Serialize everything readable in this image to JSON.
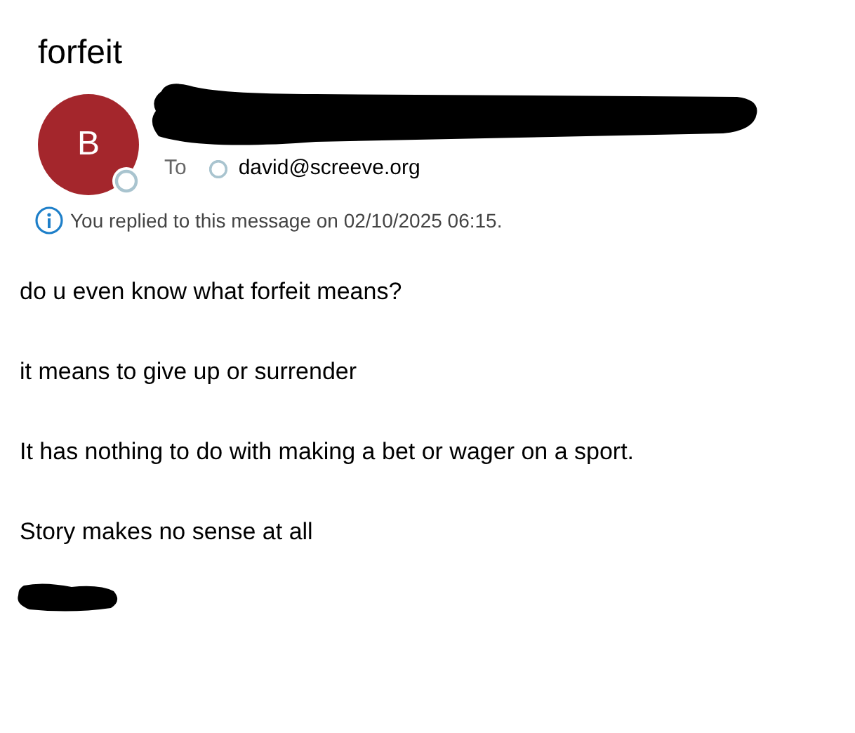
{
  "subject": "forfeit",
  "sender": {
    "initial": "B",
    "color": "#a4262c"
  },
  "recipients": {
    "label": "To",
    "items": [
      {
        "address": "david@screeve.org"
      }
    ]
  },
  "notice": "You replied to this message on 02/10/2025 06:15.",
  "body": [
    {
      "kind": "text",
      "text": "do u even know what forfeit means?"
    },
    {
      "kind": "text",
      "text": "it means to give up or surrender"
    },
    {
      "kind": "text",
      "text": "It has nothing to do with making a bet or wager on a sport."
    },
    {
      "kind": "text",
      "text": "Story makes no sense at all"
    },
    {
      "kind": "redacted"
    }
  ]
}
